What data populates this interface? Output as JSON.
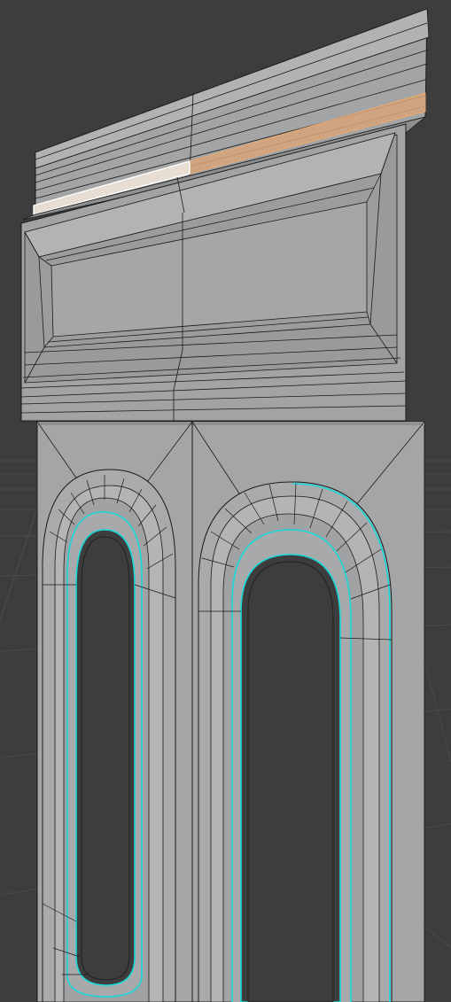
{
  "viewport": {
    "mode": "edit-mesh",
    "object": "arched-panel-column",
    "colors": {
      "background": "#3d3d3d",
      "grid": "#4a4a4a",
      "mesh_face": "#a3a5a6",
      "mesh_face_dark": "#8f9193",
      "mesh_face_light": "#b4b6b7",
      "wire": "#1b1b1b",
      "seam_highlight": "#19d8d8",
      "selection_face": "#d9a47a",
      "active_face": "#e8ddd2",
      "active_outline": "#ffffff"
    }
  }
}
